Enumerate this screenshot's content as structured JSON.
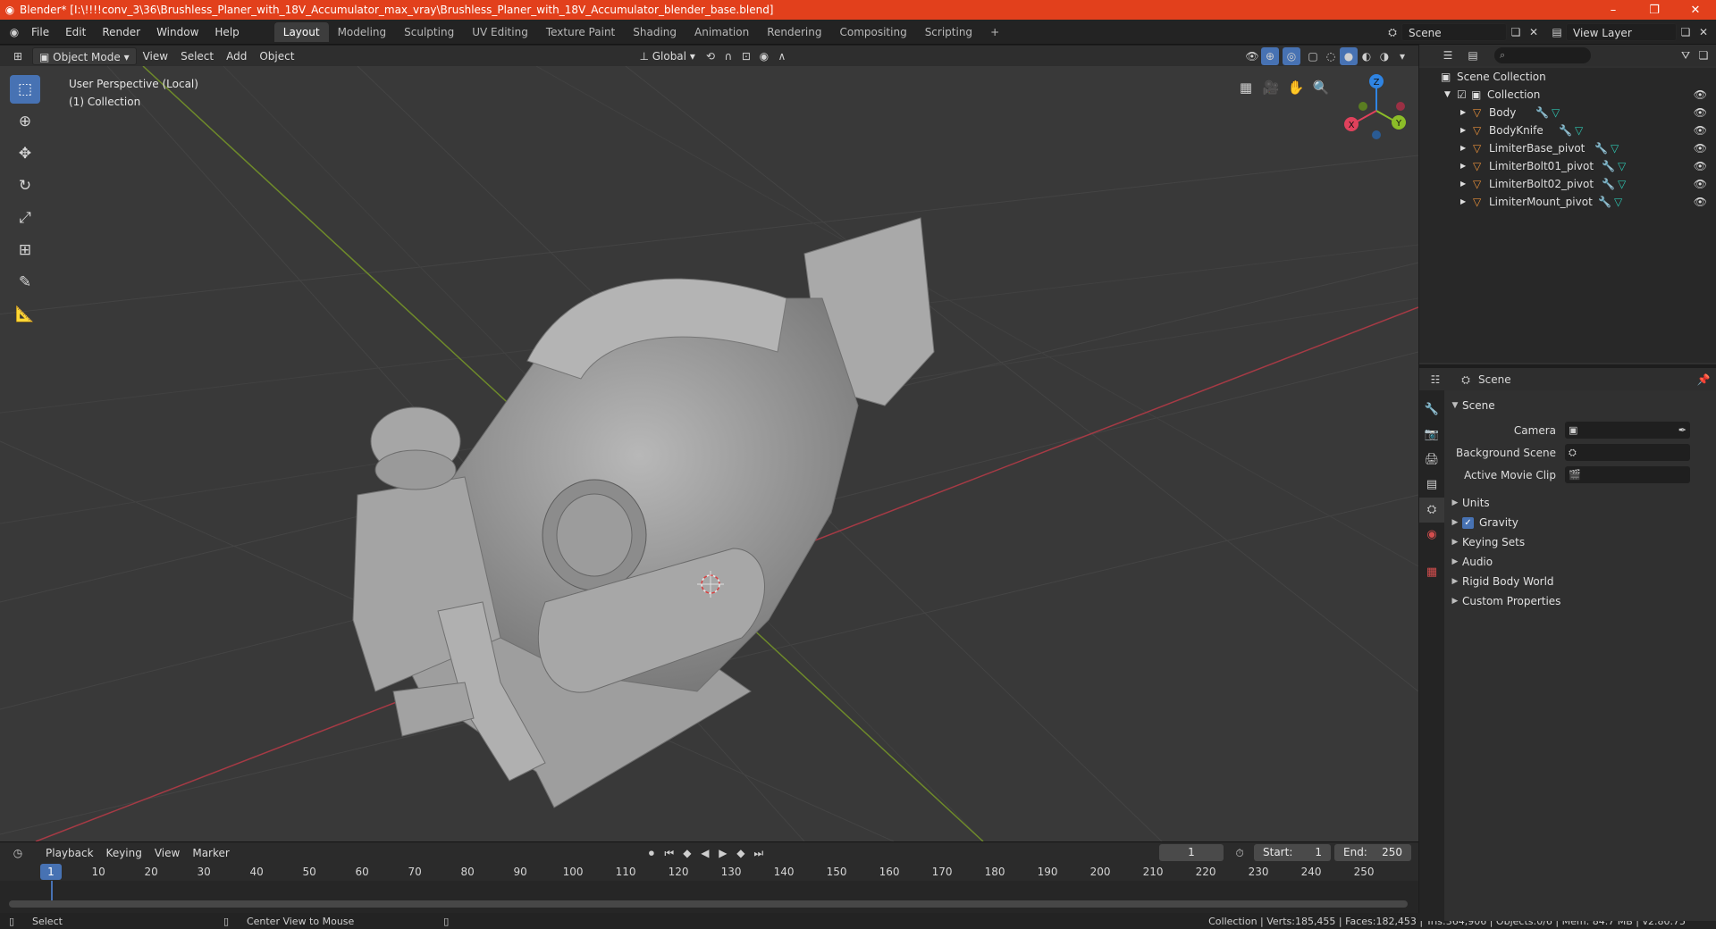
{
  "window": {
    "title": "Blender* [I:\\!!!!conv_3\\36\\Brushless_Planer_with_18V_Accumulator_max_vray\\Brushless_Planer_with_18V_Accumulator_blender_base.blend]",
    "minimize": "–",
    "restore": "❐",
    "close": "✕"
  },
  "menu": [
    "File",
    "Edit",
    "Render",
    "Window",
    "Help"
  ],
  "workspaces": [
    "Layout",
    "Modeling",
    "Sculpting",
    "UV Editing",
    "Texture Paint",
    "Shading",
    "Animation",
    "Rendering",
    "Compositing",
    "Scripting"
  ],
  "workspace_add": "+",
  "scene_selector": {
    "value": "Scene"
  },
  "view_layer_selector": {
    "value": "View Layer"
  },
  "viewport_header": {
    "mode": "Object Mode",
    "menus": [
      "View",
      "Select",
      "Add",
      "Object"
    ],
    "transform_orientation": "Global"
  },
  "viewport": {
    "perspective": "User Perspective (Local)",
    "collection": "(1) Collection",
    "gizmo": {
      "x": "X",
      "y": "Y",
      "z": "Z",
      "x_color": "#e0415c",
      "y_color": "#8bbd28",
      "z_color": "#2f84e3"
    }
  },
  "outliner": {
    "root": "Scene Collection",
    "collection": "Collection",
    "objects": [
      "Body",
      "BodyKnife",
      "LimiterBase_pivot",
      "LimiterBolt01_pivot",
      "LimiterBolt02_pivot",
      "LimiterMount_pivot"
    ]
  },
  "properties": {
    "header": "Scene",
    "section": "Scene",
    "fields": [
      {
        "label": "Camera"
      },
      {
        "label": "Background Scene"
      },
      {
        "label": "Active Movie Clip"
      }
    ],
    "panels": [
      "Units",
      "Gravity",
      "Keying Sets",
      "Audio",
      "Rigid Body World",
      "Custom Properties"
    ],
    "gravity_checked": true
  },
  "timeline": {
    "menus": [
      "Playback",
      "Keying",
      "View",
      "Marker"
    ],
    "current_frame": "1",
    "start_label": "Start:",
    "start": "1",
    "end_label": "End:",
    "end": "250",
    "ticks": [
      "10",
      "20",
      "30",
      "40",
      "50",
      "60",
      "70",
      "80",
      "90",
      "100",
      "110",
      "120",
      "130",
      "140",
      "150",
      "160",
      "170",
      "180",
      "190",
      "200",
      "210",
      "220",
      "230",
      "240",
      "250"
    ]
  },
  "status": {
    "left": "Select",
    "middle": "Center View to Mouse",
    "right": "Collection | Verts:185,455 | Faces:182,453 | Tris:364,906 | Objects:0/6 | Mem: 84.7 MB | v2.80.75"
  },
  "colors": {
    "titlebar": "#e2401c",
    "accent": "#4772b3",
    "object_icon": "#e8903a",
    "modifier_icon": "#6fa8e8",
    "mesh_icon": "#2ec4b0"
  }
}
